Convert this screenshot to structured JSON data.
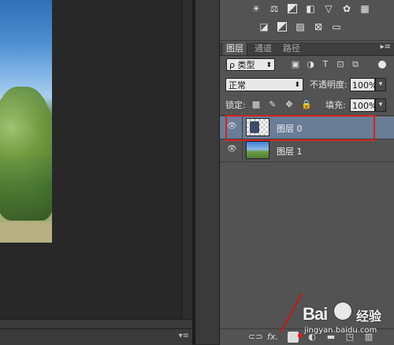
{
  "panel": {
    "tabs": [
      {
        "label": "图层",
        "active": true
      },
      {
        "label": "通道",
        "active": false
      },
      {
        "label": "路径",
        "active": false
      }
    ],
    "filter": {
      "label": "ρ 类型",
      "icons": [
        "image-filter-icon",
        "adjustment-filter-icon",
        "type-filter-icon",
        "shape-filter-icon",
        "smart-object-filter-icon"
      ]
    },
    "blend_mode": "正常",
    "opacity_label": "不透明度:",
    "opacity_value": "100%",
    "lock_label": "锁定:",
    "fill_label": "填充:",
    "fill_value": "100%",
    "layers": [
      {
        "name": "图层 0",
        "selected": true
      },
      {
        "name": "图层 1",
        "selected": false
      }
    ],
    "bottom_icons": [
      "link-icon",
      "fx-icon",
      "add-mask-icon",
      "adjustment-layer-icon",
      "group-folder-icon",
      "new-layer-icon",
      "trash-icon"
    ],
    "bottom_fx_label": "fx."
  },
  "adjustments": {
    "row1": [
      "brightness-icon",
      "levels-icon",
      "curves-icon",
      "exposure-icon",
      "vibrance-icon",
      "hsl-icon",
      "color-balance-icon"
    ],
    "row2": [
      "photo-filter-icon",
      "channel-mixer-icon",
      "gradient-map-icon",
      "selective-color-icon",
      "invert-icon"
    ]
  },
  "watermark": {
    "brand": "Bai",
    "brand2": "经验",
    "url": "jingyan.baidu.com"
  },
  "colors": {
    "highlight": "#d42222",
    "panel_bg": "#535353",
    "selected_layer": "#6a7d96"
  }
}
